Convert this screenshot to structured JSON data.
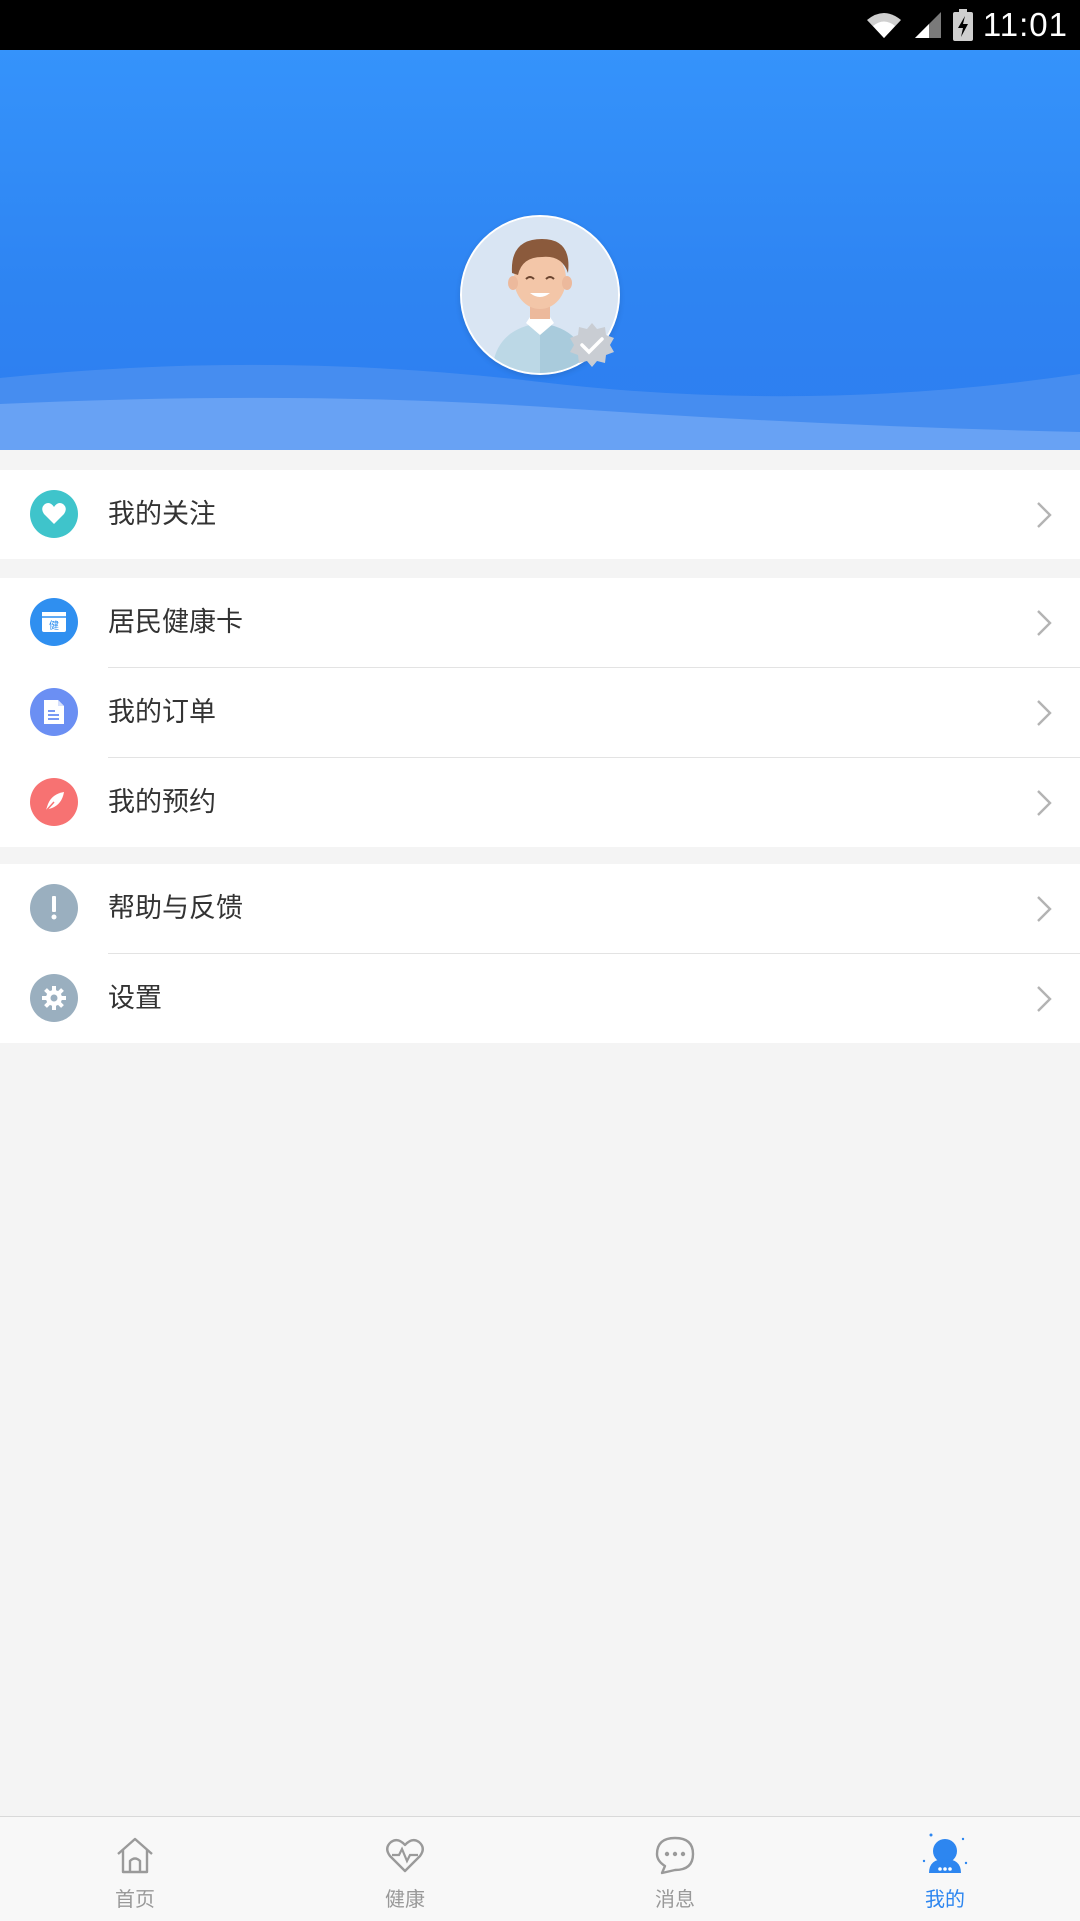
{
  "status_bar": {
    "time": "11:01"
  },
  "menu": {
    "group1": [
      {
        "label": "我的关注",
        "icon": "heart-icon",
        "color": "#3fc4cb"
      }
    ],
    "group2": [
      {
        "label": "居民健康卡",
        "icon": "health-card-icon",
        "color": "#2f8ff0"
      },
      {
        "label": "我的订单",
        "icon": "document-icon",
        "color": "#6b8ff3"
      },
      {
        "label": "我的预约",
        "icon": "quill-icon",
        "color": "#f77272"
      }
    ],
    "group3": [
      {
        "label": "帮助与反馈",
        "icon": "exclamation-icon",
        "color": "#9aafbf"
      },
      {
        "label": "设置",
        "icon": "gear-icon",
        "color": "#9aafbf"
      }
    ]
  },
  "health_card_icon_char": "健",
  "bottom_nav": [
    {
      "label": "首页",
      "icon": "home-icon"
    },
    {
      "label": "健康",
      "icon": "heart-pulse-icon"
    },
    {
      "label": "消息",
      "icon": "chat-bubble-icon"
    },
    {
      "label": "我的",
      "icon": "user-icon",
      "active": true
    }
  ],
  "colors": {
    "header": "#2f86f4",
    "accent": "#2d86f0",
    "background": "#f4f4f4"
  }
}
